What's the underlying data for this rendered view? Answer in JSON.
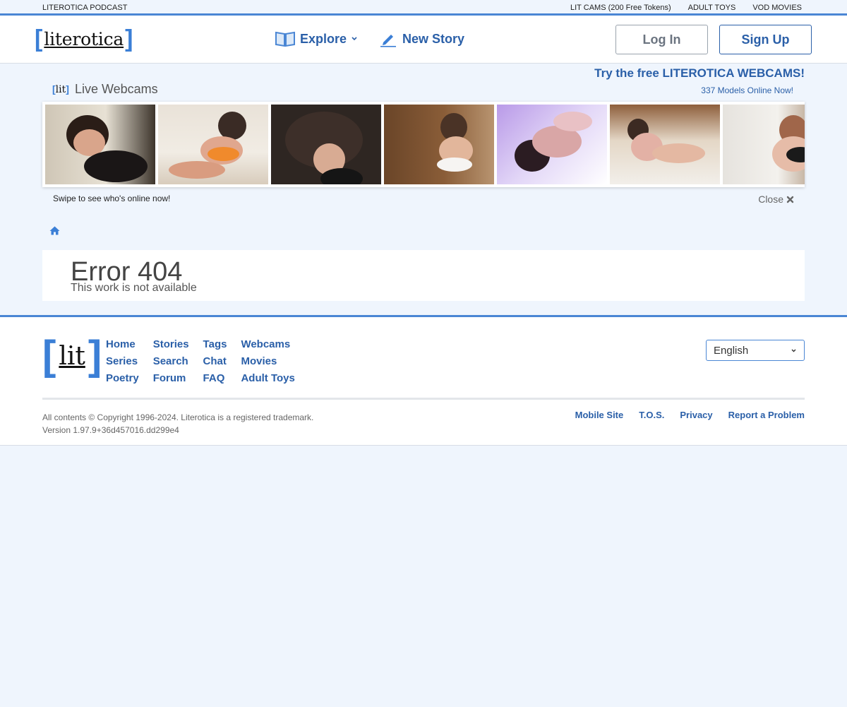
{
  "topbar": {
    "podcast": "LITEROTICA PODCAST",
    "links": [
      "LIT CAMS (200 Free Tokens)",
      "ADULT TOYS",
      "VOD MOVIES"
    ]
  },
  "header": {
    "logo_text": "literotica",
    "explore": "Explore",
    "new_story": "New Story",
    "login": "Log In",
    "signup": "Sign Up"
  },
  "webcams": {
    "brand": "lit",
    "title": "Live Webcams",
    "promo": "Try the free LITEROTICA WEBCAMS!",
    "online_count": "337 Models Online Now!",
    "swipe_text": "Swipe to see who's online now!",
    "close_label": "Close"
  },
  "error": {
    "title": "Error 404",
    "message": "This work is not available"
  },
  "footer": {
    "logo_text": "lit",
    "links": [
      [
        "Home",
        "Stories",
        "Tags",
        "Webcams"
      ],
      [
        "Series",
        "Search",
        "Chat",
        "Movies"
      ],
      [
        "Poetry",
        "Forum",
        "FAQ",
        "Adult Toys"
      ]
    ],
    "language": "English",
    "copyright": "All contents © Copyright 1996-2024. Literotica is a registered trademark.",
    "version": "Version 1.97.9+36d457016.dd299e4",
    "bottom_links": [
      "Mobile Site",
      "T.O.S.",
      "Privacy",
      "Report a Problem"
    ]
  },
  "colors": {
    "accent": "#4a86d4",
    "link": "#2a5fa8",
    "page_bg": "#eff5fd"
  }
}
